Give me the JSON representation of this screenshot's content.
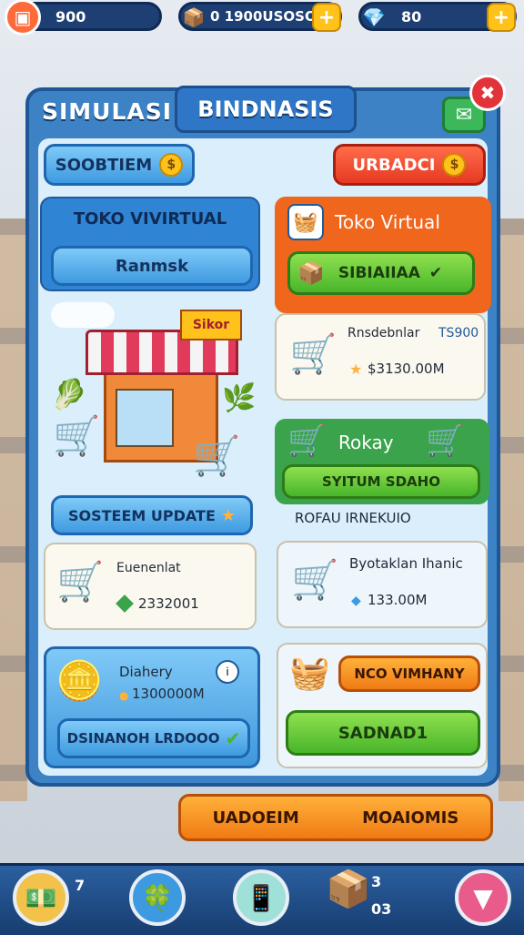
{
  "topbar": {
    "res1": {
      "icon": "calendar-icon",
      "value": "900"
    },
    "res2": {
      "icon": "crate-icon",
      "value": "0 1900USOSO"
    },
    "res3": {
      "icon": "gem-icon",
      "value": "80"
    }
  },
  "panel": {
    "title_left": "SIMULASI",
    "title_tab": "BINDNASIS",
    "btn_left": "SOOBTIEM",
    "btn_right": "URBADCI",
    "left_col": {
      "header": "TOKO VIVIRTUAL",
      "btn": "Ranmsk",
      "shop_sign": "Sikor",
      "update_btn": "SOSTEEM UPDATE",
      "item1": {
        "name": "Euenenlat",
        "value": "2332001"
      },
      "item2": {
        "name": "Diahery",
        "value": "1300000M"
      },
      "bottom_btn": "DSINANOH LRDOOO"
    },
    "right_col": {
      "header": "Toko Virtual",
      "btn": "SIBIAIIAA",
      "item1": {
        "name": "Rnsdebnlar",
        "tag": "TS900",
        "value": "$3130.00M"
      },
      "green_title": "Rokay",
      "green_btn": "SYITUM SDAHO",
      "subtitle": "ROFAU IRNEKUIO",
      "item2": {
        "name": "Byotaklan Ihanic",
        "value": "133.00M"
      },
      "orange_btn": "NCO VIMHANY",
      "green_btn2": "SADNAD1"
    }
  },
  "bottom_banner": {
    "left": "UADOEIM",
    "right": "MOAIOMIS"
  },
  "bottombar": {
    "btn1_count": "7",
    "btn4_top": "3",
    "btn4_bottom": "03"
  }
}
